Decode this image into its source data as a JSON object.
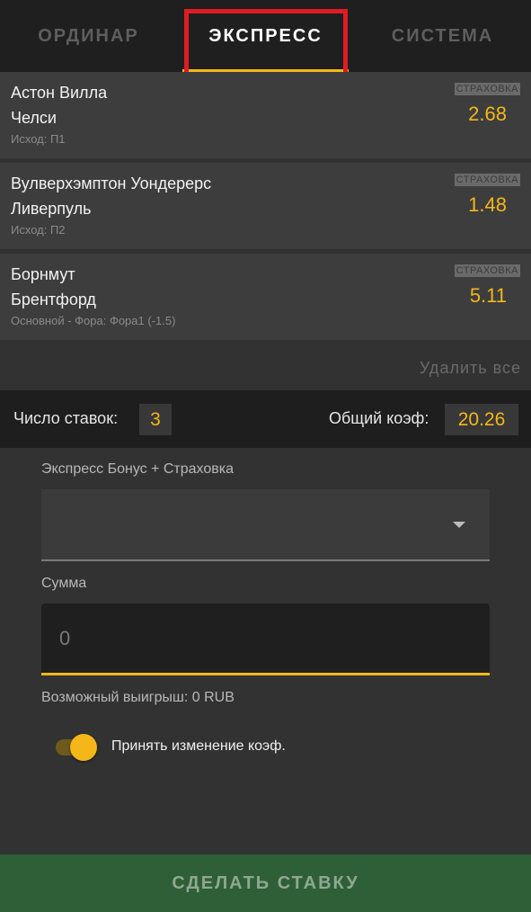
{
  "tabs": [
    {
      "label": "ОРДИНАР"
    },
    {
      "label": "ЭКСПРЕСС"
    },
    {
      "label": "СИСТЕМА"
    }
  ],
  "bets": [
    {
      "team1": "Астон Вилла",
      "team2": "Челси",
      "outcome": "Исход: П1",
      "insurance": "СТРАХОВКА",
      "odds": "2.68"
    },
    {
      "team1": "Вулверхэмптон Уондерерс",
      "team2": "Ливерпуль",
      "outcome": "Исход: П2",
      "insurance": "СТРАХОВКА",
      "odds": "1.48"
    },
    {
      "team1": "Борнмут",
      "team2": "Брентфорд",
      "outcome": "Основной -  Фора: Фора1 (-1.5)",
      "insurance": "СТРАХОВКА",
      "odds": "5.11"
    }
  ],
  "delete_all": "Удалить все",
  "summary": {
    "count_label": "Число ставок:",
    "count": "3",
    "coef_label": "Общий коэф:",
    "coef": "20.26"
  },
  "form": {
    "bonus_label": "Экспресс Бонус + Страховка",
    "bonus_value": "",
    "amount_label": "Сумма",
    "amount_placeholder": "0",
    "possible_win": "Возможный выигрыш: 0 RUB",
    "accept_label": "Принять изменение коэф."
  },
  "submit_label": "СДЕЛАТЬ СТАВКУ",
  "colors": {
    "accent": "#f5b718",
    "highlight": "#e01b24",
    "submit_bg": "#2f5f36"
  }
}
